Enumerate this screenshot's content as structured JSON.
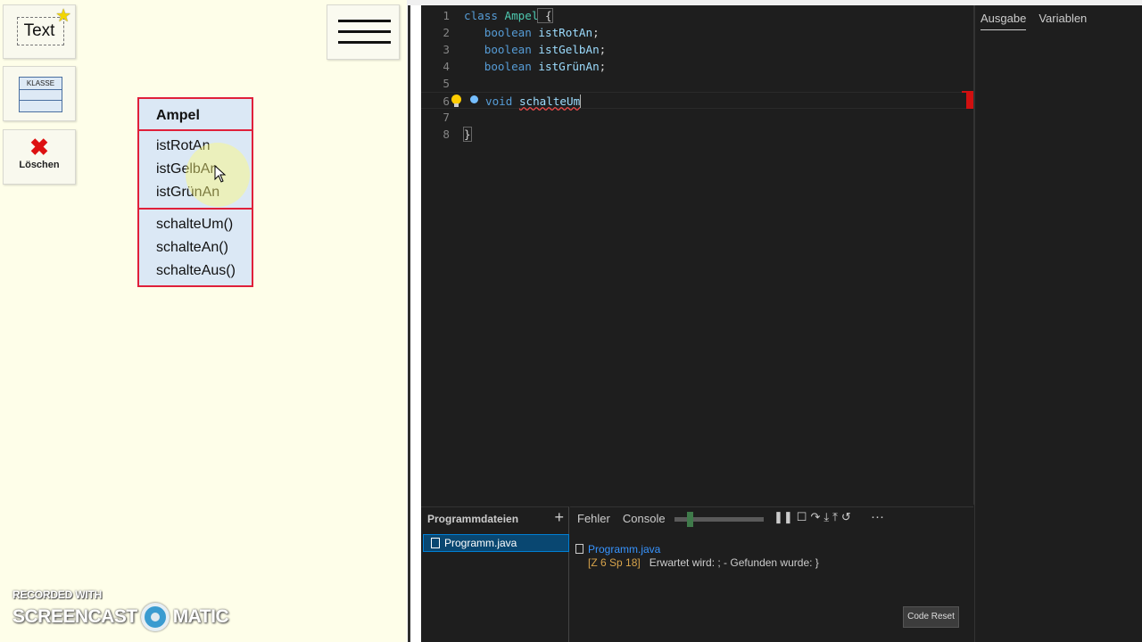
{
  "tools": {
    "text_label": "Text",
    "klasse_label": "KLASSE",
    "delete_label": "Löschen"
  },
  "uml": {
    "class_name": "Ampel",
    "attributes": [
      "istRotAn",
      "istGelbAn",
      "istGrünAn"
    ],
    "methods": [
      "schalteUm()",
      "schalteAn()",
      "schalteAus()"
    ]
  },
  "watermark": {
    "recorded": "RECORDED WITH",
    "brand_left": "SCREENCAST",
    "brand_right": "MATIC"
  },
  "editor": {
    "line_numbers": [
      "1",
      "2",
      "3",
      "4",
      "5",
      "6",
      "7",
      "8"
    ],
    "line1": {
      "kw": "class",
      "name": "Ampel",
      "brace": " {"
    },
    "line2": {
      "kw": "boolean",
      "id": "istRotAn",
      "end": ";"
    },
    "line3": {
      "kw": "boolean",
      "id": "istGelbAn",
      "end": ";"
    },
    "line4": {
      "kw": "boolean",
      "id": "istGrünAn",
      "end": ";"
    },
    "line6": {
      "kw": "void",
      "id": "schalteUm"
    },
    "line8": {
      "brace": "}"
    }
  },
  "side_panel": {
    "tabs": [
      "Ausgabe",
      "Variablen"
    ]
  },
  "files": {
    "title": "Programmdateien",
    "add": "+",
    "items": [
      "Programm.java"
    ]
  },
  "bottom": {
    "tabs": [
      "Fehler",
      "Console"
    ],
    "controls": [
      "❚❚",
      "☐",
      "↷",
      "⤓",
      "⤒",
      "↺"
    ],
    "more": "···",
    "problem_file": "Programm.java",
    "problem_location": "[Z 6 Sp 18]",
    "problem_message": "Erwartet wird: ; - Gefunden wurde: }",
    "reset_label": "Code Reset"
  },
  "colors": {
    "uml_border": "#e0203a",
    "uml_fill": "#dbe8f5",
    "editor_bg": "#1e1e1e",
    "keyword": "#569cd6",
    "type": "#4ec9b0",
    "identifier": "#9cdcfe",
    "error": "#f14c4c"
  }
}
